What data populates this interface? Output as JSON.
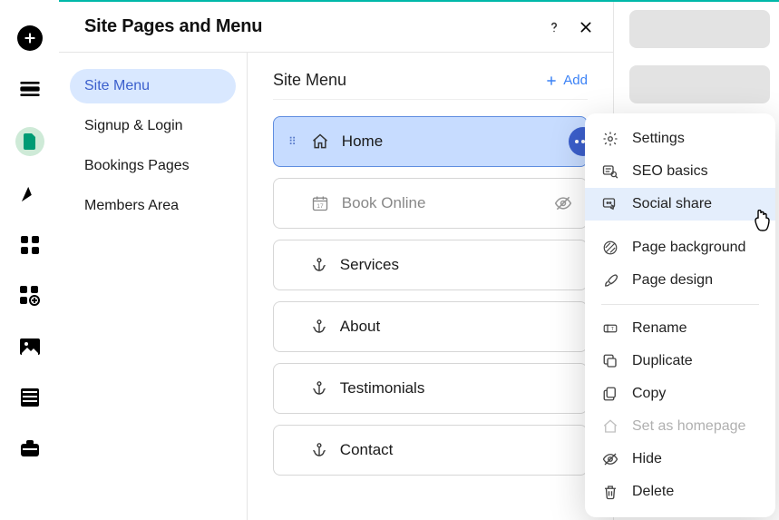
{
  "header": {
    "title": "Site Pages and Menu"
  },
  "sidebar": {
    "items": [
      {
        "label": "Site Menu",
        "active": true
      },
      {
        "label": "Signup & Login"
      },
      {
        "label": "Bookings Pages"
      },
      {
        "label": "Members Area"
      }
    ]
  },
  "main": {
    "title": "Site Menu",
    "add_label": "Add",
    "pages": [
      {
        "label": "Home",
        "icon": "home",
        "selected": true
      },
      {
        "label": "Book Online",
        "icon": "calendar",
        "hidden": true
      },
      {
        "label": "Services",
        "icon": "anchor"
      },
      {
        "label": "About",
        "icon": "anchor"
      },
      {
        "label": "Testimonials",
        "icon": "anchor"
      },
      {
        "label": "Contact",
        "icon": "anchor"
      }
    ]
  },
  "menu": {
    "items": [
      {
        "label": "Settings",
        "icon": "gear"
      },
      {
        "label": "SEO basics",
        "icon": "seo"
      },
      {
        "label": "Social share",
        "icon": "share",
        "hover": true
      },
      {
        "sep": "gap"
      },
      {
        "label": "Page background",
        "icon": "pattern"
      },
      {
        "label": "Page design",
        "icon": "brush"
      },
      {
        "sep": true
      },
      {
        "label": "Rename",
        "icon": "rename"
      },
      {
        "label": "Duplicate",
        "icon": "duplicate"
      },
      {
        "label": "Copy",
        "icon": "copy"
      },
      {
        "label": "Set as homepage",
        "icon": "home",
        "disabled": true
      },
      {
        "label": "Hide",
        "icon": "hide"
      },
      {
        "label": "Delete",
        "icon": "trash"
      }
    ]
  }
}
